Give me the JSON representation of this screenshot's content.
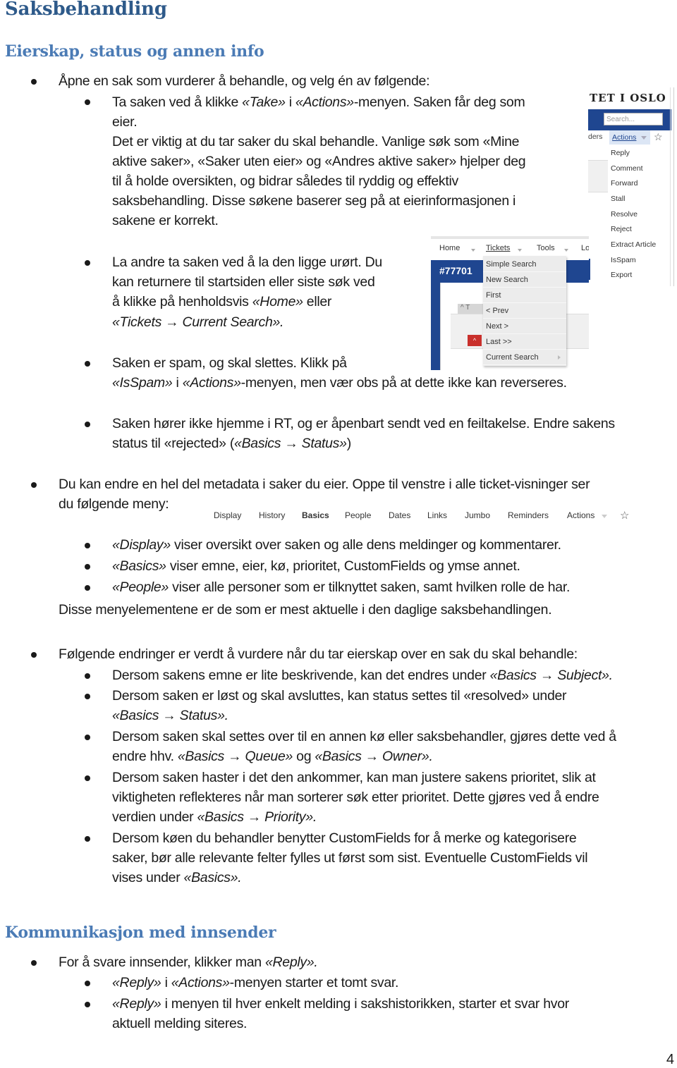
{
  "title": "Saksbehandling",
  "section1": {
    "heading": "Eierskap, status og annen info",
    "intro": "Åpne en sak som vurderer å behandle, og velg én av følgende:",
    "take": {
      "l1_a": "Ta saken ved å klikke ",
      "l1_take": "«Take»",
      "l1_b": " i ",
      "l1_actions": "«Actions»",
      "l1_c": "-menyen.  Saken får deg som",
      "l2": "eier.",
      "l3": "Det er viktig at du tar saker du skal behandle.  Vanlige søk som «Mine",
      "l4": "aktive saker», «Saker uten eier» og «Andres aktive saker» hjelper deg",
      "l5": "til å holde oversikten, og bidrar således til ryddig og effektiv",
      "l6": "saksbehandling.  Disse søkene baserer seg på at eierinformasjonen i",
      "l7": "sakene er korrekt."
    },
    "leave": {
      "l1": "La andre ta saken ved å la den ligge urørt.  Du",
      "l2": "kan returnere til startsiden eller siste søk ved",
      "l3_a": "å klikke på henholdsvis ",
      "l3_home": "«Home»",
      "l3_b": " eller",
      "l4": "«Tickets → Current Search»."
    },
    "spam": {
      "l1": "Saken er spam, og skal slettes.  Klikk på",
      "l2_isspam": "«IsSpam»",
      "l2_a": " i ",
      "l2_actions": "«Actions»",
      "l2_b": "-menyen, men vær obs på at dette ikke kan reverseres."
    },
    "reject": {
      "l1": "Saken hører ikke hjemme i RT, og er åpenbart sendt ved en feiltakelse.  Endre sakens",
      "l2_a": "status til «rejected» (",
      "l2_path": "«Basics → Status»",
      "l2_b": ")"
    },
    "metadata": {
      "l1": "Du kan endre en hel del metadata i saker du eier. Oppe til venstre i alle ticket-visninger ser",
      "l2": "du følgende meny:",
      "display_em": "«Display»",
      "display_text": " viser oversikt over saken og alle dens meldinger og kommentarer.",
      "basics_em": "«Basics»",
      "basics_text": " viser emne, eier, kø, prioritet, CustomFields og ymse annet.",
      "people_em": "«People»",
      "people_text": " viser alle personer som er tilknyttet saken, samt hvilken rolle de har.",
      "summary": "Disse menyelementene er de som er mest aktuelle i den daglige saksbehandlingen."
    },
    "changes": {
      "intro": "Følgende endringer er verdt å vurdere når du tar eierskap over en sak du skal behandle:",
      "subject_a": "Dersom sakens emne er lite beskrivende, kan det endres under ",
      "subject_path": "«Basics → Subject».",
      "status_l1": "Dersom saken er løst og skal avsluttes, kan status settes til «resolved» under",
      "status_path": "«Basics → Status».",
      "queue_l1": "Dersom saken skal settes over til en annen kø eller saksbehandler, gjøres dette ved å",
      "queue_a": "endre hhv. ",
      "queue_path": "«Basics → Queue»",
      "queue_b": " og ",
      "owner_path": "«Basics → Owner».",
      "prio_l1": "Dersom saken haster i det den ankommer, kan man justere sakens prioritet, slik at",
      "prio_l2": "viktigheten reflekteres når man sorterer søk etter prioritet.  Dette gjøres ved å endre",
      "prio_a": "verdien under ",
      "prio_path": "«Basics → Priority».",
      "cf_l1": "Dersom køen du behandler benytter CustomFields for å merke og kategorisere",
      "cf_l2": "saker, bør alle relevante felter fylles ut først som sist.  Eventuelle CustomFields vil",
      "cf_a": "vises under ",
      "cf_path": "«Basics»."
    }
  },
  "section2": {
    "heading": "Kommunikasjon med innsender",
    "intro_a": "For å svare innsender, klikker man ",
    "intro_reply": "«Reply».",
    "item1_reply": "«Reply»",
    "item1_a": " i ",
    "item1_actions": "«Actions»",
    "item1_b": "-menyen starter et tomt svar.",
    "item2_reply": "«Reply»",
    "item2_l1": " i menyen til hver enkelt melding i sakshistorikken, starter et svar hvor",
    "item2_l2": "aktuell melding siteres."
  },
  "actions_screenshot": {
    "org_title": "TET I OSLO",
    "search_placeholder": "Search...",
    "left_fragment": "ders",
    "actions_label": "Actions",
    "items": [
      "Reply",
      "Comment",
      "Forward",
      "Stall",
      "Resolve",
      "Reject",
      "Extract Article",
      "IsSpam",
      "Export"
    ]
  },
  "tickets_screenshot": {
    "nav": [
      "Home",
      "Tickets",
      "Tools",
      "Lo"
    ],
    "ticket_id": "#77701",
    "tab_fragment": "T",
    "items": [
      "Simple Search",
      "New Search",
      "First",
      "< Prev",
      "Next >",
      "Last >>",
      "Current Search"
    ]
  },
  "ticket_tabs": {
    "items": [
      "Display",
      "History",
      "Basics",
      "People",
      "Dates",
      "Links",
      "Jumbo",
      "Reminders",
      "Actions"
    ]
  },
  "page_number": "4",
  "colors": {
    "heading1": "#2e5a8a",
    "heading2": "#4b7bb5",
    "rt_blue": "#1f4690"
  }
}
